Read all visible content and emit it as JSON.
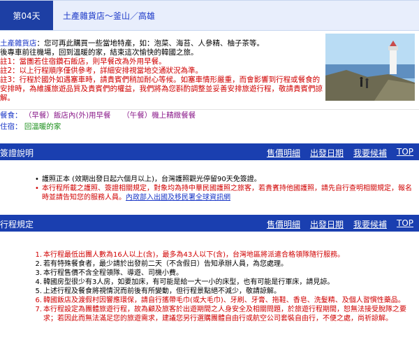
{
  "day": {
    "badge": "第04天",
    "title": "土產雜貨店～釜山／高雄"
  },
  "content": {
    "shop_label": "土產雜貨店",
    "shop_text": "：您可再此購買一些當地特產，如：泡菜、海苔、人參精、柚子茶等。",
    "return_text": "後專車前往機場，回到溫暖的家，結束這次愉快的韓國之旅。",
    "note1": "註1：當團若住宿鑽石飯店，則早餐改為外用早餐。",
    "note2": "註2：以上行程順序僅供參考，詳細安排視當地交通狀況為準。",
    "note3": "註3：行程於國外如遇塞車時，請貴賓們稍加耐心等候。如塞車情形嚴重，而會影響到行程或餐食的安排時，為維護旅遊品質及貴賓們的權益，我們將為您斟酌調整並妥善安排旅遊行程，敬請貴賓們諒解。"
  },
  "meals": {
    "label": "餐食：",
    "breakfast": "（早餐）飯店內(外)用早餐",
    "lunch": "（午餐）機上精緻餐餐"
  },
  "lodging": {
    "label": "住宿：",
    "value": "回溫暖的家"
  },
  "nav_links": [
    "售價明細",
    "出發日期",
    "我要候補",
    "TOP"
  ],
  "visa": {
    "title": "簽證說明",
    "items": [
      "護照正本 (效期出發日起六個月以上)，台灣護照觀光停留90天免簽證。",
      "本行程所載之護照、簽證相關規定，對象均為持中華民國護照之旅客，若貴賓持他國護照，請先自行查明相關規定，報名時並請告知您的服務人員。"
    ],
    "link_text": "內政部入出國及移民署全球資訊網"
  },
  "rules": {
    "title": "行程規定",
    "items": [
      {
        "num": "1.",
        "text": "本行程最低出團人數為16人以上(含)，最多為43人以下(含)，台灣地區將派遣合格領隊隨行服務。",
        "color": "red"
      },
      {
        "num": "2.",
        "text": "若有特殊餐食者，最少請於出發前二天（不含假日）告知承辦人員，為您處理。",
        "color": "black"
      },
      {
        "num": "3.",
        "text": "本行程售價不含全程領隊、導遊、司機小費。",
        "color": "black"
      },
      {
        "num": "4.",
        "text": "韓國房型很少有3人房，如要加床，有可能是給一大一小的床型，也有可能是行軍床，請見諒。",
        "color": "black"
      },
      {
        "num": "5.",
        "text": "上述行程及餐食將視情況而前後有所變動，但行程景點絕不減少，敬請諒解。",
        "color": "black"
      },
      {
        "num": "6.",
        "text": "韓國飯店及渡假村因響應環保，請自行攜帶毛巾(或大毛巾)、牙刷、牙膏、拖鞋、香皂、洗髮精、及個人習慣性藥品。",
        "color": "red"
      },
      {
        "num": "7.",
        "text": "本行程設定為團體旅遊行程，故為顧及旅客於出遊期間之人身安全及相關問題，於旅遊行程期間，恕無法接受脫隊之要求；若因此而無法滿足您的旅遊需求，建議您另行選購團體自由行或航空公司套裝自由行，不便之處，尚祈諒解。",
        "color": "red"
      }
    ]
  },
  "colors": {
    "bar": "#1a3fb0",
    "badge": "#1d3fa4",
    "link_blue": "#1a37c7",
    "note_red": "#d00000",
    "green": "#1a8f1a"
  }
}
